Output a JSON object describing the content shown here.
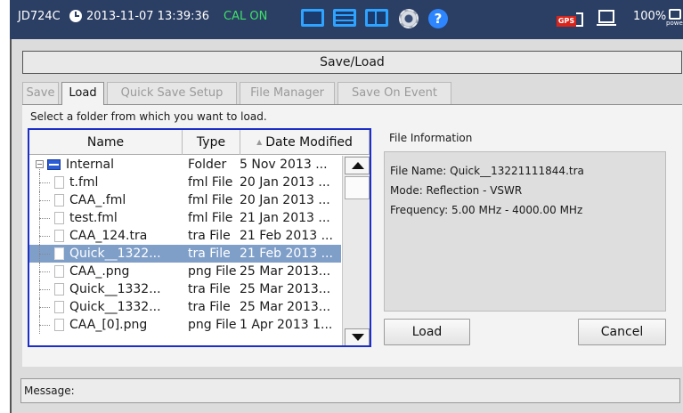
{
  "status_bar": {
    "model": "JD724C",
    "datetime": "2013-11-07 13:39:36",
    "cal_status": "CAL ON",
    "cal_color": "#3fe06a",
    "gps_label": "GPS",
    "battery": "100%",
    "power_label": "power",
    "icons": [
      "clock-icon",
      "single-view-icon",
      "dual-view-icon",
      "split-view-icon",
      "settings-gear-icon",
      "help-icon",
      "gps-usb-icon",
      "display-icon",
      "battery-power-icon"
    ]
  },
  "window": {
    "title": "Save/Load",
    "tabs": [
      {
        "label": "Save",
        "active": false
      },
      {
        "label": "Load",
        "active": true
      },
      {
        "label": "Quick Save Setup",
        "active": false
      },
      {
        "label": "File Manager",
        "active": false
      },
      {
        "label": "Save On Event",
        "active": false
      }
    ],
    "instruction": "Select a folder from which you want to load."
  },
  "file_list": {
    "columns": [
      "Name",
      "Type",
      "Date Modified"
    ],
    "sort_indicator": "▲",
    "border_color": "#1d2ec8",
    "folder": {
      "name": "Internal",
      "type": "Folder",
      "date": "5 Nov 2013 ...",
      "expander": "−"
    },
    "files": [
      {
        "name": "t.fml",
        "type": "fml File",
        "date": "20 Jan 2013 ...",
        "selected": false
      },
      {
        "name": "CAA_.fml",
        "type": "fml File",
        "date": "20 Jan 2013 ...",
        "selected": false
      },
      {
        "name": "test.fml",
        "type": "fml File",
        "date": "21 Jan 2013 ...",
        "selected": false
      },
      {
        "name": "CAA_124.tra",
        "type": "tra File",
        "date": "21 Feb 2013 ...",
        "selected": false
      },
      {
        "name": "Quick__1322...",
        "type": "tra File",
        "date": "21 Feb 2013 ...",
        "selected": true
      },
      {
        "name": "CAA_.png",
        "type": "png File",
        "date": "25 Mar 2013...",
        "selected": false
      },
      {
        "name": "Quick__1332...",
        "type": "tra File",
        "date": "25 Mar 2013...",
        "selected": false
      },
      {
        "name": "Quick__1332...",
        "type": "tra File",
        "date": "25 Mar 2013...",
        "selected": false
      },
      {
        "name": "CAA_[0].png",
        "type": "png File",
        "date": "1 Apr 2013 1...",
        "selected": false
      }
    ]
  },
  "file_info": {
    "heading": "File Information",
    "file_name": "File Name: Quick__13221111844.tra",
    "mode": "Mode: Reflection - VSWR",
    "frequency": "Frequency: 5.00 MHz - 4000.00 MHz"
  },
  "buttons": {
    "load": "Load",
    "cancel": "Cancel"
  },
  "message_bar": {
    "label": "Message:"
  },
  "colors": {
    "top_bar": "#2b3e63",
    "selection": "#7f9fc9",
    "panel": "#dcdcdc"
  }
}
